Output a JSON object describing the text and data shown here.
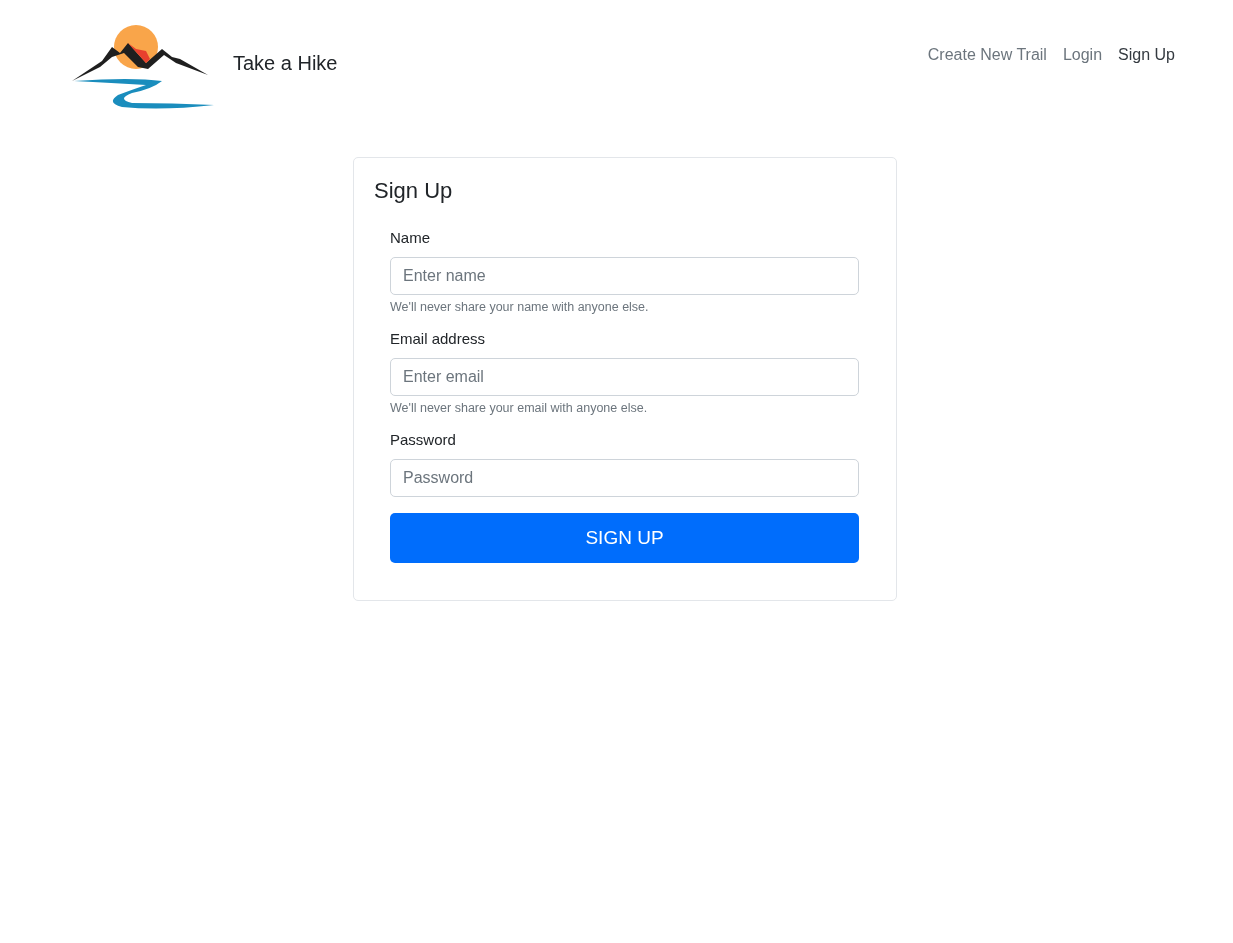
{
  "navbar": {
    "brand": "Take a Hike",
    "links": [
      {
        "label": "Create New Trail",
        "selected": false
      },
      {
        "label": "Login",
        "selected": false
      },
      {
        "label": "Sign Up",
        "selected": true
      }
    ]
  },
  "card": {
    "title": "Sign Up",
    "fields": [
      {
        "label": "Name",
        "placeholder": "Enter name",
        "help": "We'll never share your name with anyone else."
      },
      {
        "label": "Email address",
        "placeholder": "Enter email",
        "help": "We'll never share your email with anyone else."
      },
      {
        "label": "Password",
        "placeholder": "Password"
      }
    ],
    "submit": "SIGN UP"
  }
}
